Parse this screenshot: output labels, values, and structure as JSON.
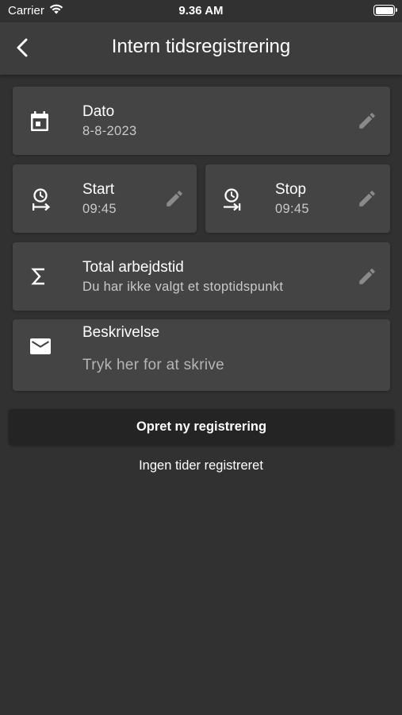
{
  "status_bar": {
    "carrier": "Carrier",
    "time": "9.36 AM"
  },
  "nav": {
    "title": "Intern tidsregistrering",
    "back_icon": "chevron-left-icon"
  },
  "date": {
    "label": "Dato",
    "value": "8-8-2023",
    "icon": "calendar-icon"
  },
  "start": {
    "label": "Start",
    "value": "09:45",
    "icon": "clock-start-icon"
  },
  "stop": {
    "label": "Stop",
    "value": "09:45",
    "icon": "clock-stop-icon"
  },
  "total": {
    "label": "Total arbejdstid",
    "value": "Du har ikke valgt et stoptidspunkt",
    "icon": "sigma-icon"
  },
  "description": {
    "label": "Beskrivelse",
    "placeholder": "Tryk her for at skrive",
    "icon": "mail-icon"
  },
  "actions": {
    "create_label": "Opret ny registrering",
    "empty_text": "Ingen tider registreret"
  },
  "colors": {
    "background": "#313131",
    "card": "#444444",
    "navbar": "#3d3d3d",
    "button": "#242424",
    "edit_icon": "#8a8a8a"
  }
}
